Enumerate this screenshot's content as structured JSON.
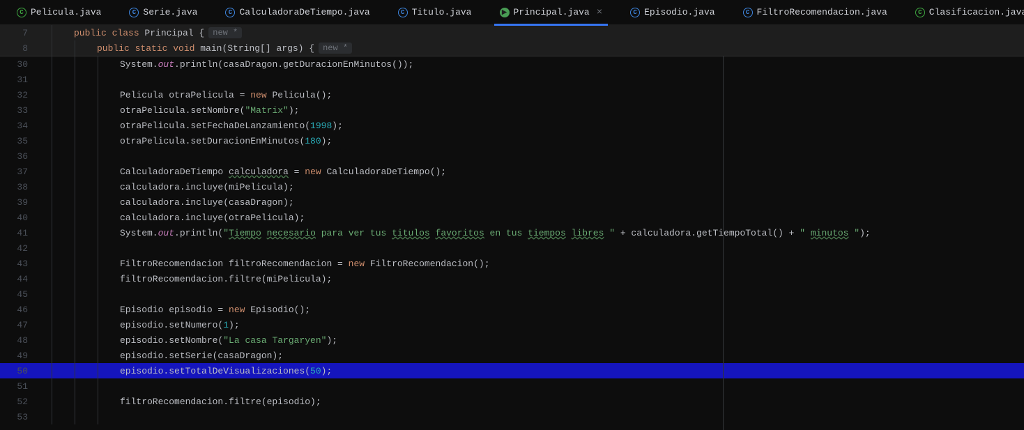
{
  "tabs": [
    {
      "label": "Pelicula.java",
      "iconClass": "green",
      "active": false
    },
    {
      "label": "Serie.java",
      "iconClass": "",
      "active": false
    },
    {
      "label": "CalculadoraDeTiempo.java",
      "iconClass": "",
      "active": false
    },
    {
      "label": "Titulo.java",
      "iconClass": "",
      "active": false
    },
    {
      "label": "Principal.java",
      "iconClass": "run",
      "active": true
    },
    {
      "label": "Episodio.java",
      "iconClass": "",
      "active": false
    },
    {
      "label": "FiltroRecomendacion.java",
      "iconClass": "",
      "active": false
    },
    {
      "label": "Clasificacion.java",
      "iconClass": "green",
      "active": false
    }
  ],
  "sticky": [
    {
      "num": "7",
      "indent": 1,
      "tokens": [
        {
          "t": "public ",
          "c": "kw"
        },
        {
          "t": "class ",
          "c": "kw"
        },
        {
          "t": "Principal {",
          "c": ""
        }
      ],
      "hint": "new *"
    },
    {
      "num": "8",
      "indent": 2,
      "tokens": [
        {
          "t": "public ",
          "c": "kw"
        },
        {
          "t": "static ",
          "c": "kw"
        },
        {
          "t": "void ",
          "c": "kw"
        },
        {
          "t": "main",
          "c": ""
        },
        {
          "t": "(String[] args) {",
          "c": ""
        }
      ],
      "hint": "new *"
    }
  ],
  "lines": [
    {
      "num": "30",
      "indent": 3,
      "current": false,
      "tokens": [
        {
          "t": "System.",
          "c": ""
        },
        {
          "t": "out",
          "c": "type"
        },
        {
          "t": ".println(casaDragon.getDuracionEnMinutos());",
          "c": ""
        }
      ]
    },
    {
      "num": "31",
      "indent": 0,
      "current": false,
      "tokens": []
    },
    {
      "num": "32",
      "indent": 3,
      "current": false,
      "tokens": [
        {
          "t": "Pelicula otraPelicula = ",
          "c": ""
        },
        {
          "t": "new ",
          "c": "kw"
        },
        {
          "t": "Pelicula();",
          "c": ""
        }
      ]
    },
    {
      "num": "33",
      "indent": 3,
      "current": false,
      "tokens": [
        {
          "t": "otraPelicula.setNombre(",
          "c": ""
        },
        {
          "t": "\"Matrix\"",
          "c": "str"
        },
        {
          "t": ");",
          "c": ""
        }
      ]
    },
    {
      "num": "34",
      "indent": 3,
      "current": false,
      "tokens": [
        {
          "t": "otraPelicula.setFechaDeLanzamiento(",
          "c": ""
        },
        {
          "t": "1998",
          "c": "num"
        },
        {
          "t": ");",
          "c": ""
        }
      ]
    },
    {
      "num": "35",
      "indent": 3,
      "current": false,
      "tokens": [
        {
          "t": "otraPelicula.setDuracionEnMinutos(",
          "c": ""
        },
        {
          "t": "180",
          "c": "num"
        },
        {
          "t": ");",
          "c": ""
        }
      ]
    },
    {
      "num": "36",
      "indent": 0,
      "current": false,
      "tokens": []
    },
    {
      "num": "37",
      "indent": 3,
      "current": false,
      "tokens": [
        {
          "t": "CalculadoraDeTiempo ",
          "c": ""
        },
        {
          "t": "calculadora",
          "c": "wavy"
        },
        {
          "t": " = ",
          "c": ""
        },
        {
          "t": "new ",
          "c": "kw"
        },
        {
          "t": "CalculadoraDeTiempo();",
          "c": ""
        }
      ]
    },
    {
      "num": "38",
      "indent": 3,
      "current": false,
      "tokens": [
        {
          "t": "calculadora.incluye(miPelicula);",
          "c": ""
        }
      ]
    },
    {
      "num": "39",
      "indent": 3,
      "current": false,
      "tokens": [
        {
          "t": "calculadora.incluye(casaDragon);",
          "c": ""
        }
      ]
    },
    {
      "num": "40",
      "indent": 3,
      "current": false,
      "tokens": [
        {
          "t": "calculadora.incluye(otraPelicula);",
          "c": ""
        }
      ]
    },
    {
      "num": "41",
      "indent": 3,
      "current": false,
      "tokens": [
        {
          "t": "System.",
          "c": ""
        },
        {
          "t": "out",
          "c": "type"
        },
        {
          "t": ".println(",
          "c": ""
        },
        {
          "t": "\"",
          "c": "str"
        },
        {
          "t": "Tiempo",
          "c": "str wavy"
        },
        {
          "t": " ",
          "c": "str"
        },
        {
          "t": "necesario",
          "c": "str wavy"
        },
        {
          "t": " para ver tus ",
          "c": "str"
        },
        {
          "t": "titulos",
          "c": "str wavy"
        },
        {
          "t": " ",
          "c": "str"
        },
        {
          "t": "favoritos",
          "c": "str wavy"
        },
        {
          "t": " en tus ",
          "c": "str"
        },
        {
          "t": "tiempos",
          "c": "str wavy"
        },
        {
          "t": " ",
          "c": "str"
        },
        {
          "t": "libres",
          "c": "str wavy"
        },
        {
          "t": " \"",
          "c": "str"
        },
        {
          "t": " + calculadora.getTiempoTotal() + ",
          "c": ""
        },
        {
          "t": "\" ",
          "c": "str"
        },
        {
          "t": "minutos",
          "c": "str wavy"
        },
        {
          "t": " \"",
          "c": "str"
        },
        {
          "t": ");",
          "c": ""
        }
      ]
    },
    {
      "num": "42",
      "indent": 0,
      "current": false,
      "tokens": []
    },
    {
      "num": "43",
      "indent": 3,
      "current": false,
      "tokens": [
        {
          "t": "FiltroRecomendacion filtroRecomendacion = ",
          "c": ""
        },
        {
          "t": "new ",
          "c": "kw"
        },
        {
          "t": "FiltroRecomendacion();",
          "c": ""
        }
      ]
    },
    {
      "num": "44",
      "indent": 3,
      "current": false,
      "tokens": [
        {
          "t": "filtroRecomendacion.filtre(miPelicula);",
          "c": ""
        }
      ]
    },
    {
      "num": "45",
      "indent": 0,
      "current": false,
      "tokens": []
    },
    {
      "num": "46",
      "indent": 3,
      "current": false,
      "tokens": [
        {
          "t": "Episodio episodio = ",
          "c": ""
        },
        {
          "t": "new ",
          "c": "kw"
        },
        {
          "t": "Episodio();",
          "c": ""
        }
      ]
    },
    {
      "num": "47",
      "indent": 3,
      "current": false,
      "tokens": [
        {
          "t": "episodio.setNumero(",
          "c": ""
        },
        {
          "t": "1",
          "c": "num"
        },
        {
          "t": ");",
          "c": ""
        }
      ]
    },
    {
      "num": "48",
      "indent": 3,
      "current": false,
      "tokens": [
        {
          "t": "episodio.setNombre(",
          "c": ""
        },
        {
          "t": "\"La casa Targaryen\"",
          "c": "str"
        },
        {
          "t": ");",
          "c": ""
        }
      ]
    },
    {
      "num": "49",
      "indent": 3,
      "current": false,
      "tokens": [
        {
          "t": "episodio.setSerie(casaDragon);",
          "c": ""
        }
      ]
    },
    {
      "num": "50",
      "indent": 3,
      "current": true,
      "tokens": [
        {
          "t": "episodio.setTotalDeVisualizaciones(",
          "c": ""
        },
        {
          "t": "50",
          "c": "num"
        },
        {
          "t": ");",
          "c": ""
        }
      ]
    },
    {
      "num": "51",
      "indent": 0,
      "current": false,
      "tokens": []
    },
    {
      "num": "52",
      "indent": 3,
      "current": false,
      "tokens": [
        {
          "t": "filtroRecomendacion.filtre(episodio);",
          "c": ""
        }
      ]
    },
    {
      "num": "53",
      "indent": 0,
      "current": false,
      "tokens": []
    }
  ]
}
